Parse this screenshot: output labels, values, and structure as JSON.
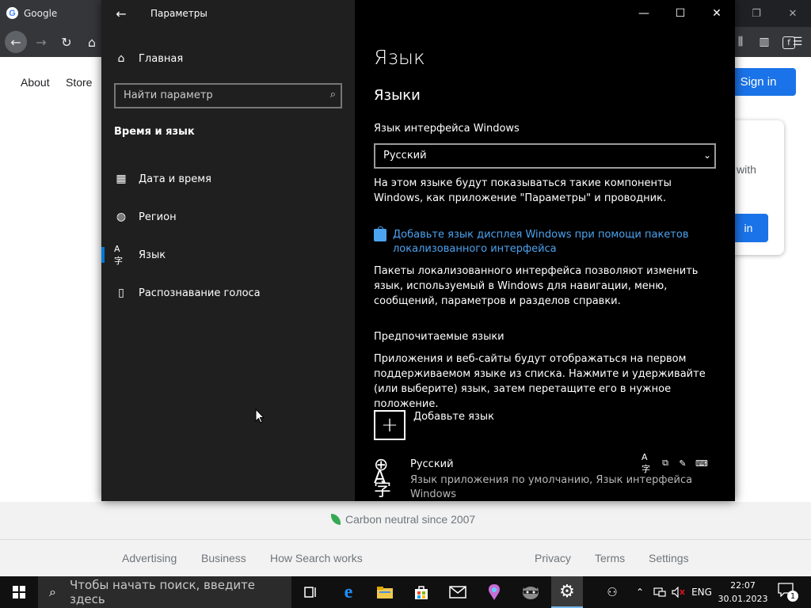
{
  "browser": {
    "tab_title": "Google",
    "google_letter": "G",
    "nav_links": [
      "About",
      "Store"
    ],
    "sign_in": "Sign in",
    "card_text": "with",
    "card_button": "in",
    "carbon": "Carbon neutral since 2007",
    "footer_left": [
      "Advertising",
      "Business",
      "How Search works"
    ],
    "footer_right": [
      "Privacy",
      "Terms",
      "Settings"
    ]
  },
  "settings": {
    "window_title": "Параметры",
    "home": "Главная",
    "search_placeholder": "Найти параметр",
    "section": "Время и язык",
    "nav": [
      {
        "label": "Дата и время",
        "icon": "calendar-clock-icon"
      },
      {
        "label": "Регион",
        "icon": "globe-icon"
      },
      {
        "label": "Язык",
        "icon": "language-icon",
        "selected": true
      },
      {
        "label": "Распознавание голоса",
        "icon": "microphone-icon"
      }
    ],
    "page_title": "Язык",
    "languages_heading": "Языки",
    "display_language_label": "Язык интерфейса Windows",
    "display_language_value": "Русский",
    "display_language_desc": "На этом языке будут показываться такие компоненты Windows, как приложение \"Параметры\" и проводник.",
    "store_link": "Добавьте язык дисплея Windows при помощи пакетов локализованного интерфейса",
    "lip_desc": "Пакеты локализованного интерфейса позволяют изменить язык, используемый в Windows для навигации, меню, сообщений, параметров и разделов справки.",
    "preferred_heading": "Предпочитаемые языки",
    "preferred_desc": "Приложения и веб-сайты будут отображаться на первом поддерживаемом языке из списка. Нажмите и удерживайте (или выберите) язык, затем перетащите его в нужное положение.",
    "add_language": "Добавьте язык",
    "lang_name": "Русский",
    "lang_desc": "Язык приложения по умолчанию, Язык интерфейса Windows"
  },
  "taskbar": {
    "search_placeholder": "Чтобы начать поиск, введите здесь",
    "input_lang": "ENG",
    "time": "22:07",
    "date": "30.01.2023",
    "notification_count": "1"
  }
}
